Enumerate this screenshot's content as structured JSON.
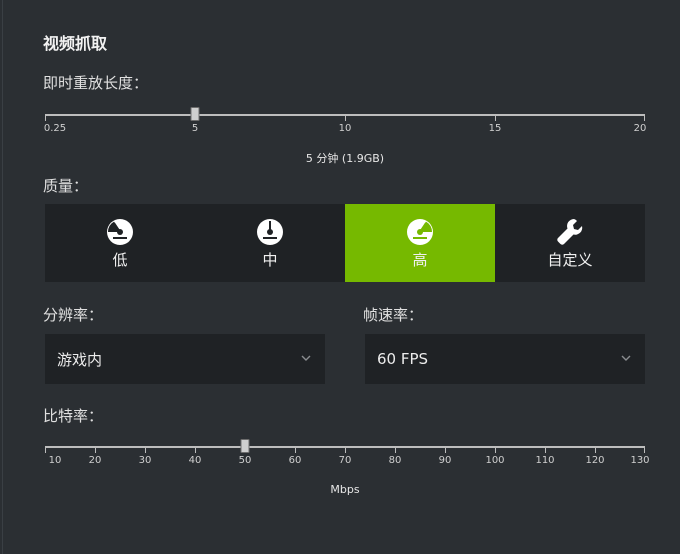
{
  "title": "视频抓取",
  "replay": {
    "label": "即时重放长度：",
    "ticks": [
      "0.25",
      "5",
      "10",
      "15",
      "20"
    ],
    "tick_values": [
      0.25,
      5,
      10,
      15,
      20
    ],
    "min": 0,
    "max": 20,
    "value": 5,
    "caption": "5 分钟 (1.9GB)"
  },
  "quality": {
    "label": "质量：",
    "options": [
      {
        "label": "低",
        "icon": "gauge-low-icon"
      },
      {
        "label": "中",
        "icon": "gauge-medium-icon"
      },
      {
        "label": "高",
        "icon": "gauge-high-icon"
      },
      {
        "label": "自定义",
        "icon": "wrench-icon"
      }
    ],
    "selected": 2
  },
  "resolution": {
    "label": "分辨率：",
    "value": "游戏内"
  },
  "framerate": {
    "label": "帧速率：",
    "value": "60 FPS"
  },
  "bitrate": {
    "label": "比特率：",
    "ticks": [
      "10",
      "20",
      "30",
      "40",
      "50",
      "60",
      "70",
      "80",
      "90",
      "100",
      "110",
      "120",
      "130"
    ],
    "min": 10,
    "max": 130,
    "value": 50,
    "caption": "Mbps"
  },
  "colors": {
    "accent": "#76b900",
    "panel": "#2b2f33",
    "control": "#1f2225"
  }
}
